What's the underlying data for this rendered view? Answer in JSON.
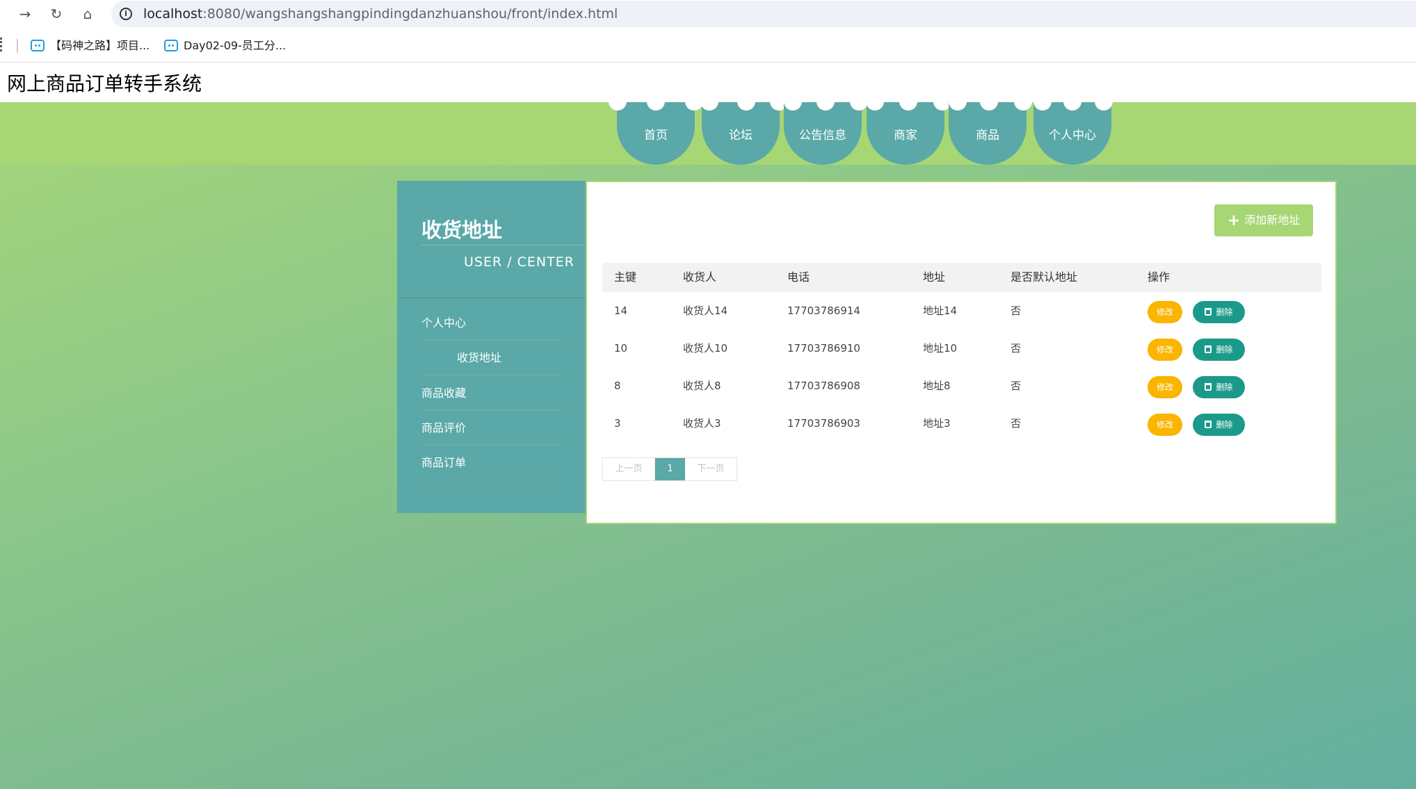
{
  "browser": {
    "url_host": "localhost",
    "url_path": ":8080/wangshangshangpindingdanzhuanshou/front/index.html",
    "bookmarks": [
      {
        "label": "【码神之路】项目..."
      },
      {
        "label": "Day02-09-员工分..."
      }
    ]
  },
  "site": {
    "title": "网上商品订单转手系统"
  },
  "nav": {
    "tabs": [
      {
        "label": "首页"
      },
      {
        "label": "论坛"
      },
      {
        "label": "公告信息"
      },
      {
        "label": "商家"
      },
      {
        "label": "商品"
      },
      {
        "label": "个人中心"
      }
    ]
  },
  "sidebar": {
    "title": "收货地址",
    "subtitle": "USER / CENTER",
    "items": [
      {
        "label": "个人中心"
      },
      {
        "label": "收货地址"
      },
      {
        "label": "商品收藏"
      },
      {
        "label": "商品评价"
      },
      {
        "label": "商品订单"
      }
    ]
  },
  "content": {
    "add_button": "添加新地址",
    "columns": [
      "主键",
      "收货人",
      "电话",
      "地址",
      "是否默认地址",
      "操作"
    ],
    "rows": [
      {
        "id": "14",
        "name": "收货人14",
        "phone": "17703786914",
        "address": "地址14",
        "default": "否"
      },
      {
        "id": "10",
        "name": "收货人10",
        "phone": "17703786910",
        "address": "地址10",
        "default": "否"
      },
      {
        "id": "8",
        "name": "收货人8",
        "phone": "17703786908",
        "address": "地址8",
        "default": "否"
      },
      {
        "id": "3",
        "name": "收货人3",
        "phone": "17703786903",
        "address": "地址3",
        "default": "否"
      }
    ],
    "edit_label": "修改",
    "delete_label": "删除"
  },
  "pager": {
    "prev": "上一页",
    "current": "1",
    "next": "下一页"
  },
  "colors": {
    "accent": "#5aa8a8",
    "nav_strip": "#a7d674",
    "edit": "#f9b500",
    "delete": "#1b9a8a"
  }
}
